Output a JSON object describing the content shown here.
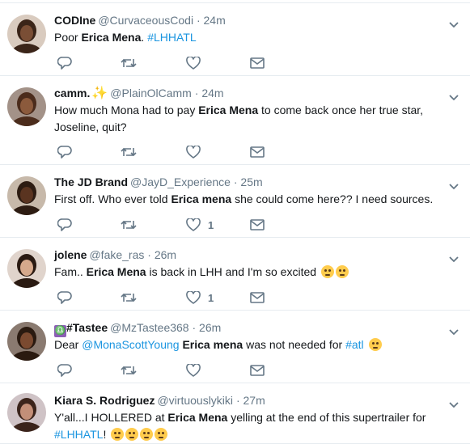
{
  "colors": {
    "link": "#1b95e0",
    "secondary": "#657786",
    "border": "#e6ecf0"
  },
  "tweets": [
    {
      "name": "CODIne",
      "handle": "@CurvaceousCodi",
      "dot": "·",
      "time": "24m",
      "text": [
        "Poor ",
        {
          "b": "Erica Mena"
        },
        ". ",
        {
          "tag": "#LHHATL"
        }
      ],
      "like_count": ""
    },
    {
      "name": "camm.",
      "name_emoji": "✨",
      "handle": "@PlainOlCamm",
      "dot": "·",
      "time": "24m",
      "text": [
        "How much Mona had to pay ",
        {
          "b": "Erica Mena"
        },
        " to come back once her true star, Joseline, quit?"
      ],
      "like_count": ""
    },
    {
      "name": "The JD Brand",
      "handle": "@JayD_Experience",
      "dot": "·",
      "time": "25m",
      "text": [
        "First off. Who ever told ",
        {
          "b": "Erica mena"
        },
        " she could come here?? I need sources."
      ],
      "like_count": "1"
    },
    {
      "name": "jolene",
      "handle": "@fake_ras",
      "dot": "·",
      "time": "26m",
      "text": [
        "Fam.. ",
        {
          "b": "Erica Mena"
        },
        " is back in LHH and I'm so excited ",
        {
          "emoji": "loudly-crying-face"
        },
        {
          "emoji": "weary-face"
        }
      ],
      "like_count": "1"
    },
    {
      "name": "#Tastee",
      "name_icon": "♎",
      "handle": "@MzTastee368",
      "dot": "·",
      "time": "26m",
      "text": [
        "Dear ",
        {
          "mention": "@MonaScottYoung"
        },
        "  ",
        {
          "b": "Erica mena"
        },
        " was not needed for ",
        {
          "tag": "#atl"
        },
        " ",
        {
          "emoji": "grimacing-face"
        }
      ],
      "like_count": ""
    },
    {
      "name": "Kiara S. Rodriguez",
      "handle": "@virtuouslykiki",
      "dot": "·",
      "time": "27m",
      "text": [
        "Y'all...I HOLLERED at ",
        {
          "b": "Erica Mena"
        },
        " yelling at the end of this supertrailer for ",
        {
          "tag": "#LHHATL"
        },
        "! ",
        {
          "emoji": "tears-of-joy-face"
        },
        {
          "emoji": "weary-face"
        },
        {
          "emoji": "weary-face"
        },
        {
          "emoji": "weary-face"
        }
      ],
      "like_count": ""
    }
  ],
  "icons": {
    "reply": "reply-icon",
    "retweet": "retweet-icon",
    "like": "heart-icon",
    "dm": "envelope-icon",
    "menu": "chevron-down-icon"
  }
}
